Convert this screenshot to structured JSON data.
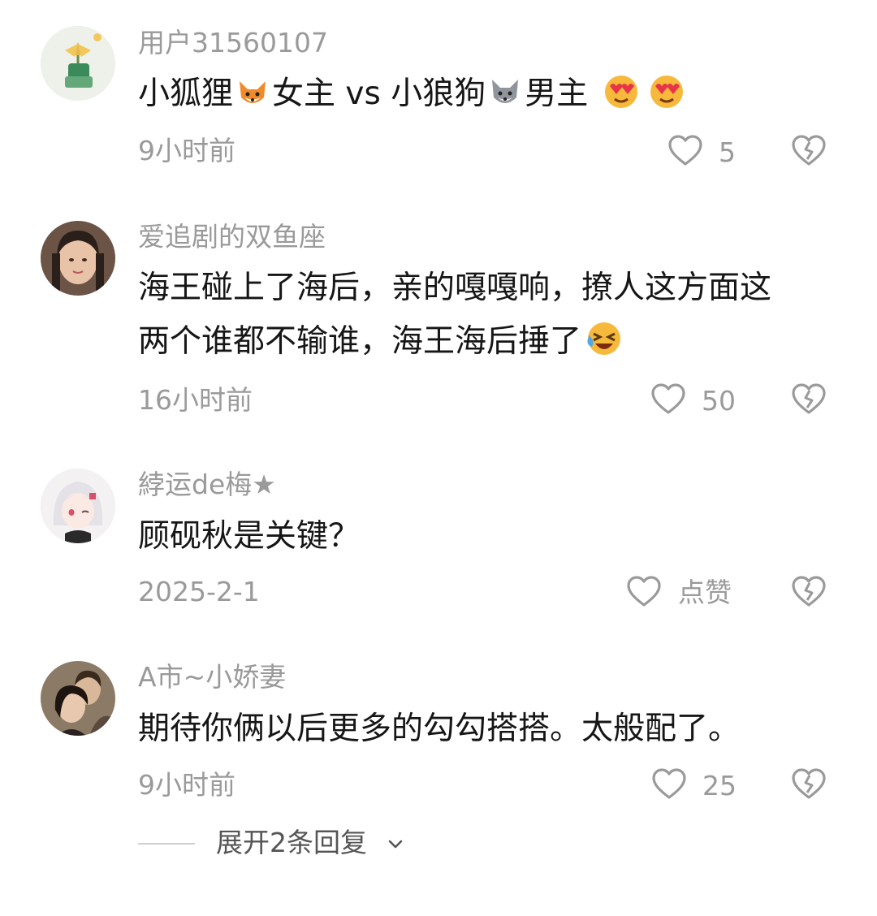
{
  "comments": [
    {
      "username": "用户31560107",
      "content_parts": [
        "小狐狸",
        "女主 vs 小狼狗",
        "男主 "
      ],
      "time": "9小时前",
      "likes": "5",
      "emojis": [
        "fox-emoji",
        "wolf-emoji",
        "heart-eyes-emoji",
        "heart-eyes-emoji"
      ]
    },
    {
      "username": "爱追剧的双鱼座",
      "content_line1": "海王碰上了海后，亲的嘎嘎响，撩人这方面这",
      "content_line2": "两个谁都不输谁，海王海后捶了",
      "time": "16小时前",
      "likes": "50",
      "emojis": [
        "laughing-crying-emoji"
      ]
    },
    {
      "username": "綍运de梅★",
      "content": "顾砚秋是关键？",
      "time": "2025-2-1",
      "likes": "点赞"
    },
    {
      "username": "A市~小娇妻",
      "content": "期待你俩以后更多的勾勾搭搭。太般配了。",
      "time": "9小时前",
      "likes": "25"
    }
  ],
  "expand_replies": "展开2条回复",
  "icons": {
    "like": "heart-outline-icon",
    "dislike": "broken-heart-icon",
    "expand": "chevron-down-icon"
  },
  "colors": {
    "text_primary": "#161616",
    "text_secondary": "#9a9a9a"
  }
}
